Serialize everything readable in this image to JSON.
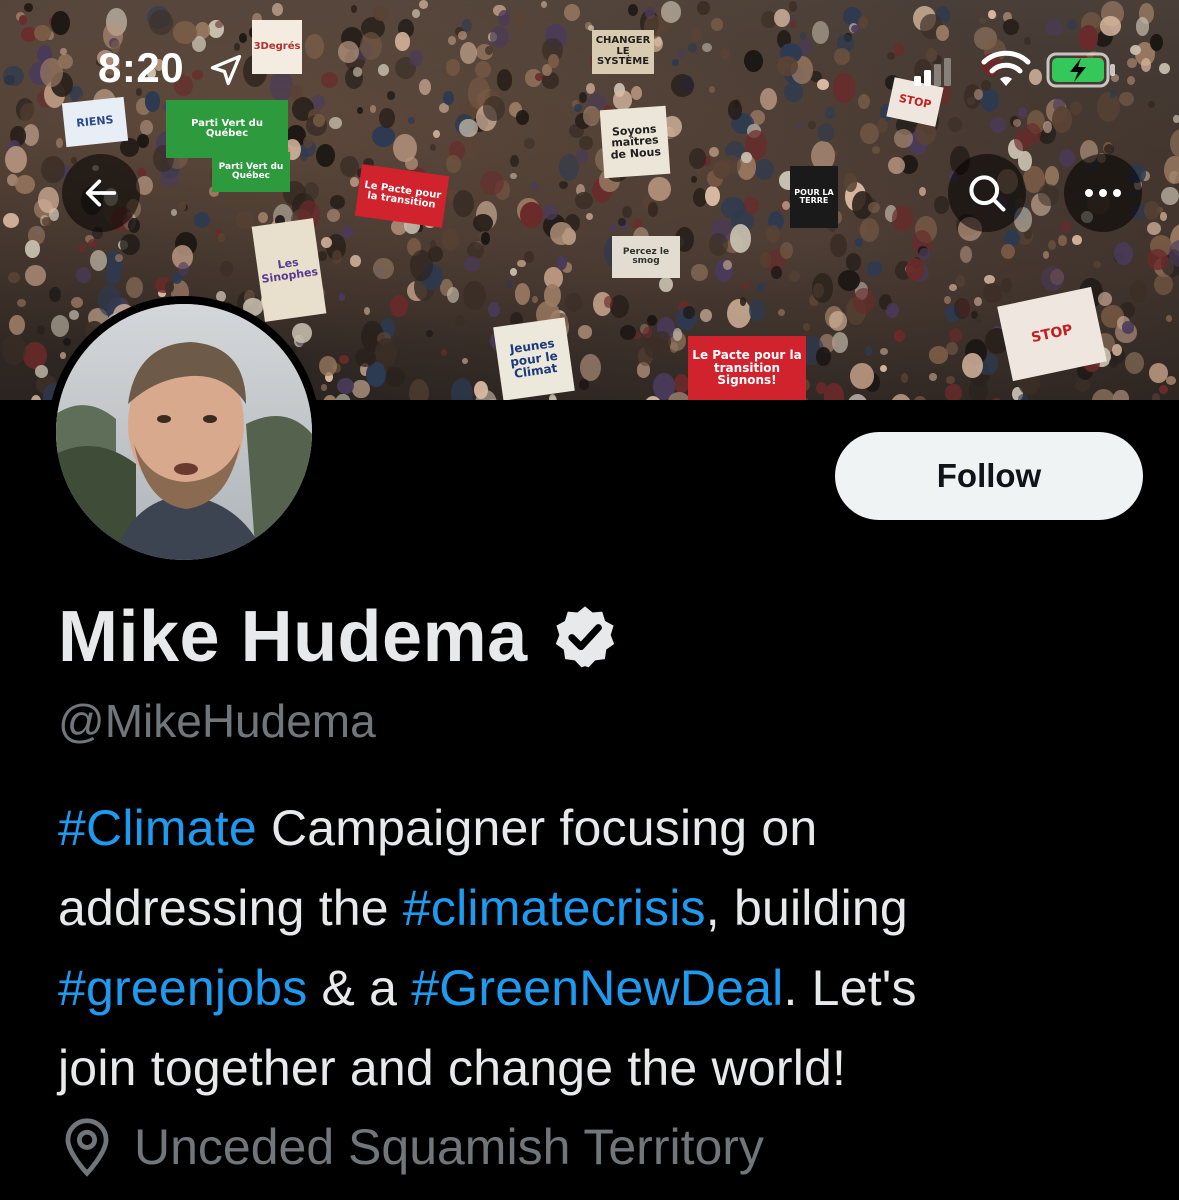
{
  "status_bar": {
    "time": "8:20"
  },
  "header": {
    "back_icon": "arrow-left-icon",
    "search_icon": "search-icon",
    "more_icon": "more-horizontal-icon"
  },
  "banner": {
    "signs": [
      {
        "text": "RIENS",
        "bg": "#e8eef5",
        "fg": "#2a4a8a"
      },
      {
        "text": "3Degrés",
        "bg": "#f4ece0",
        "fg": "#b03030"
      },
      {
        "text": "Parti Vert du Québec",
        "bg": "#2e9a3e",
        "fg": "#ffffff"
      },
      {
        "text": "Parti Vert du Québec",
        "bg": "#2e9a3e",
        "fg": "#ffffff"
      },
      {
        "text": "Le Pacte pour la transition",
        "bg": "#d0232e",
        "fg": "#ffffff"
      },
      {
        "text": "Soyons maîtres de Nous",
        "bg": "#ece6d8",
        "fg": "#202020"
      },
      {
        "text": "CHANGER LE SYSTÈME",
        "bg": "#d8cbb0",
        "fg": "#202020"
      },
      {
        "text": "Les Sinophes",
        "bg": "#e8e0cc",
        "fg": "#5a3a90"
      },
      {
        "text": "Jeunes pour le Climat",
        "bg": "#ede8dc",
        "fg": "#1a3a7a"
      },
      {
        "text": "Le Pacte pour la transition Signons!",
        "bg": "#d0232e",
        "fg": "#ffffff"
      },
      {
        "text": "STOP",
        "bg": "#efe6e0",
        "fg": "#c02020"
      },
      {
        "text": "STOP",
        "bg": "#efe6e0",
        "fg": "#c02020"
      },
      {
        "text": "POUR LA TERRE",
        "bg": "#1a1a1a",
        "fg": "#ffffff"
      },
      {
        "text": "Percez le smog",
        "bg": "#e2ddd0",
        "fg": "#303030"
      }
    ]
  },
  "profile": {
    "avatar_label": "avatar",
    "follow_label": "Follow",
    "name": "Mike Hudema",
    "handle": "@MikeHudema",
    "bio": {
      "line1_tag": "#Climate",
      "line1_text": " Campaigner focusing on",
      "line2_text": "addressing the ",
      "line2_tag": "#climatecrisis",
      "line2_tail": ", building",
      "line3_tag": "#greenjobs",
      "line3_mid": " & a ",
      "line3_tag2": "#GreenNewDeal",
      "line3_tail": ". Let's",
      "line4_text": "join together and change the world!"
    },
    "location": "Unceded Squamish Territory"
  },
  "colors": {
    "background": "#000000",
    "primary_text": "#e7e9ea",
    "secondary_text": "#71767b",
    "link": "#1d9bf0",
    "follow_bg": "#eff3f4"
  }
}
